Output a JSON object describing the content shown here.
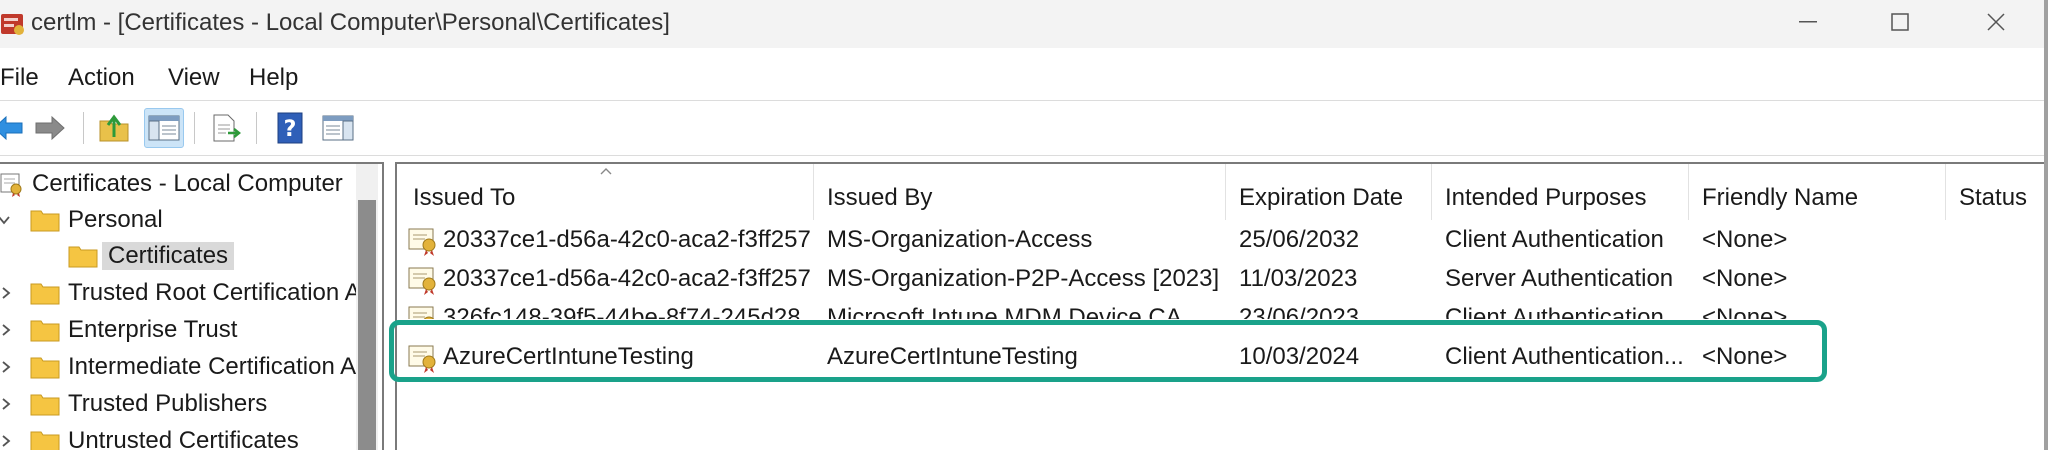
{
  "window": {
    "title": "certlm - [Certificates - Local Computer\\Personal\\Certificates]",
    "controls": [
      "minimize-icon",
      "maximize-icon",
      "close-icon"
    ]
  },
  "menu": [
    "File",
    "Action",
    "View",
    "Help"
  ],
  "toolbar": {
    "buttons": [
      "back-arrow-icon",
      "forward-arrow-icon",
      "up-folder-icon",
      "show-hide-console-tree-icon",
      "export-list-icon",
      "help-icon",
      "show-hide-action-pane-icon"
    ],
    "active": "show-hide-console-tree-icon"
  },
  "tree": {
    "root": "Certificates - Local Computer",
    "items": [
      {
        "label": "Personal",
        "expanded": true
      },
      {
        "label": "Certificates",
        "selected": true
      },
      {
        "label": "Trusted Root Certification A"
      },
      {
        "label": "Enterprise Trust"
      },
      {
        "label": "Intermediate Certification A"
      },
      {
        "label": "Trusted Publishers"
      },
      {
        "label": "Untrusted Certificates"
      }
    ]
  },
  "list": {
    "columns": [
      "Issued To",
      "Issued By",
      "Expiration Date",
      "Intended Purposes",
      "Friendly Name",
      "Status"
    ],
    "sorted_column": "Issued To",
    "rows": [
      {
        "issued_to": "20337ce1-d56a-42c0-aca2-f3ff257...",
        "issued_by": "MS-Organization-Access",
        "expiration": "25/06/2032",
        "purposes": "Client Authentication",
        "friendly": "<None>"
      },
      {
        "issued_to": "20337ce1-d56a-42c0-aca2-f3ff257...",
        "issued_by": "MS-Organization-P2P-Access [2023]",
        "expiration": "11/03/2023",
        "purposes": "Server Authentication",
        "friendly": "<None>"
      },
      {
        "issued_to": "326fc148-39f5-44be-8f74-245d28...",
        "issued_by": "Microsoft Intune MDM Device CA",
        "expiration": "23/06/2023",
        "purposes": "Client Authentication",
        "friendly": "<None>"
      },
      {
        "issued_to": "AzureCertIntuneTesting",
        "issued_by": "AzureCertIntuneTesting",
        "expiration": "10/03/2024",
        "purposes": "Client Authentication...",
        "friendly": "<None>"
      }
    ],
    "highlighted_row": "AzureCertIntuneTesting"
  },
  "colors": {
    "highlight": "#1aa28a",
    "selection": "#d9d9d9",
    "titlebar": "#f3f3f3",
    "folder": "#f5c542"
  }
}
